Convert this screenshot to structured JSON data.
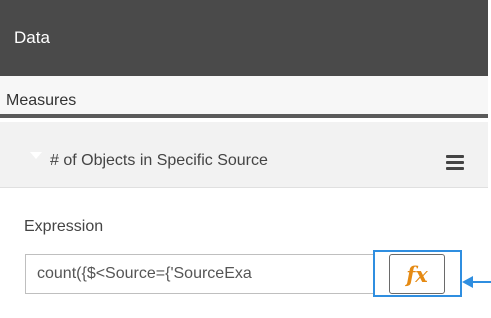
{
  "header": {
    "title": "Data"
  },
  "measures": {
    "section_label": "Measures",
    "item": {
      "title": "# of Objects in Specific Source",
      "menu_icon": "hamburger-menu-icon"
    }
  },
  "expression": {
    "label": "Expression",
    "value": "count({$<Source={'SourceExa",
    "fx_button": {
      "label": "fx",
      "icon": "function-icon"
    }
  },
  "annotation": {
    "color": "#2f8ee0",
    "icon": "pointer-arrow-icon"
  },
  "colors": {
    "header_bg": "#4a4a4a",
    "fx": "#e58a13",
    "highlight": "#2f8ee0"
  }
}
